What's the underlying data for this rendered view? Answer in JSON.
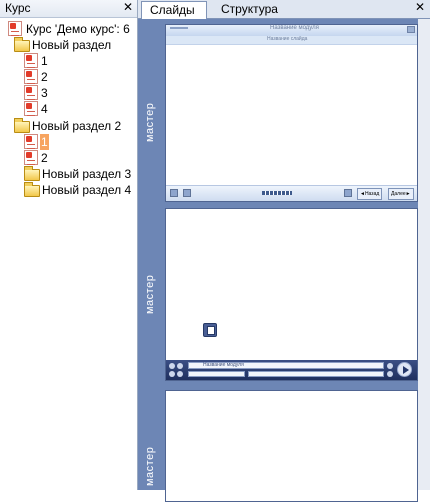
{
  "left_panel": {
    "title": "Курс",
    "close": "✕",
    "tree": [
      {
        "label": "Курс 'Демо курс': 6",
        "type": "doc"
      },
      {
        "label": "Новый раздел",
        "type": "folder"
      },
      {
        "label": "1",
        "type": "doc"
      },
      {
        "label": "2",
        "type": "doc"
      },
      {
        "label": "3",
        "type": "doc"
      },
      {
        "label": "4",
        "type": "doc"
      },
      {
        "label": "Новый раздел 2",
        "type": "folder"
      },
      {
        "label": "1",
        "type": "doc",
        "selected": true
      },
      {
        "label": "2",
        "type": "doc"
      },
      {
        "label": "Новый раздел 3",
        "type": "folder"
      },
      {
        "label": "Новый раздел 4",
        "type": "folder"
      }
    ]
  },
  "right_panel": {
    "tabs": [
      "Слайды",
      "Структура"
    ],
    "active_tab": "Слайды",
    "close": "✕",
    "slides": [
      {
        "side_label": "мастер",
        "header_title": "Название модуля",
        "sub_title": "Название слайда",
        "nav_prev": "◄Назад",
        "nav_next": "Далее►"
      },
      {
        "side_label": "мастер",
        "module_name": "Название модуля"
      },
      {
        "side_label": "мастер"
      }
    ]
  }
}
